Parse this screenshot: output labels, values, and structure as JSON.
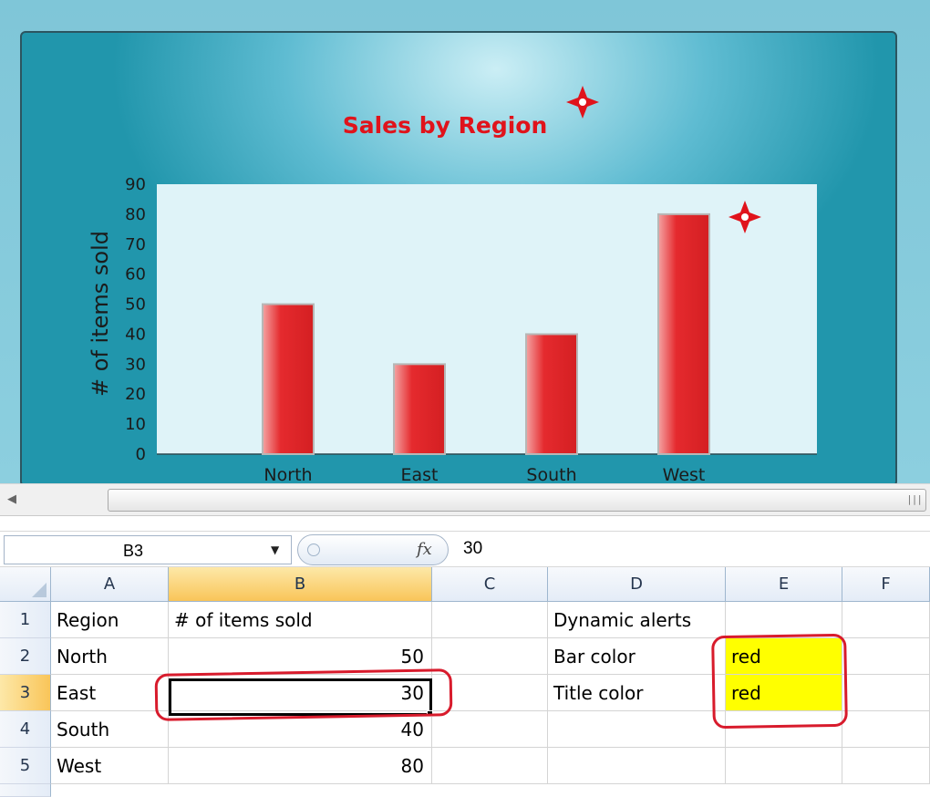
{
  "chart_data": {
    "type": "bar",
    "title": "Sales by Region",
    "title_color": "#e0131b",
    "categories": [
      "North",
      "East",
      "South",
      "West"
    ],
    "values": [
      50,
      30,
      40,
      80
    ],
    "ylabel": "# of items sold",
    "xlabel": "",
    "ylim": [
      0,
      90
    ],
    "yticks": [
      0,
      10,
      20,
      30,
      40,
      50,
      60,
      70,
      80,
      90
    ],
    "bar_color": "#e52a2e",
    "plot_background": "#dff3f8",
    "legend": "none",
    "grid": false
  },
  "formula_bar": {
    "name_box": "B3",
    "fx_icon": "fx-function-icon",
    "value": "30"
  },
  "grid": {
    "columns": [
      "A",
      "B",
      "C",
      "D",
      "E",
      "F"
    ],
    "selected_column": "B",
    "selected_row": "3",
    "rows": [
      {
        "num": "1",
        "A": "Region",
        "B": "# of items sold",
        "C": "",
        "D": "Dynamic alerts",
        "E": "",
        "F": ""
      },
      {
        "num": "2",
        "A": "North",
        "B": "50",
        "C": "",
        "D": "Bar color",
        "E": "red",
        "F": ""
      },
      {
        "num": "3",
        "A": "East",
        "B": "30",
        "C": "",
        "D": "Title color",
        "E": "red",
        "F": ""
      },
      {
        "num": "4",
        "A": "South",
        "B": "40",
        "C": "",
        "D": "",
        "E": "",
        "F": ""
      },
      {
        "num": "5",
        "A": "West",
        "B": "80",
        "C": "",
        "D": "",
        "E": "",
        "F": ""
      }
    ]
  },
  "colors": {
    "highlight_yellow": "#ffff00",
    "annotation_red": "#d81b2c",
    "alert_marker": "#e0131b"
  },
  "icons": {
    "alert_marker": "alert-star-icon",
    "scroll_left": "scroll-left-arrow-icon",
    "scroll_grip": "scroll-grip-icon",
    "dropdown": "dropdown-arrow-icon"
  }
}
